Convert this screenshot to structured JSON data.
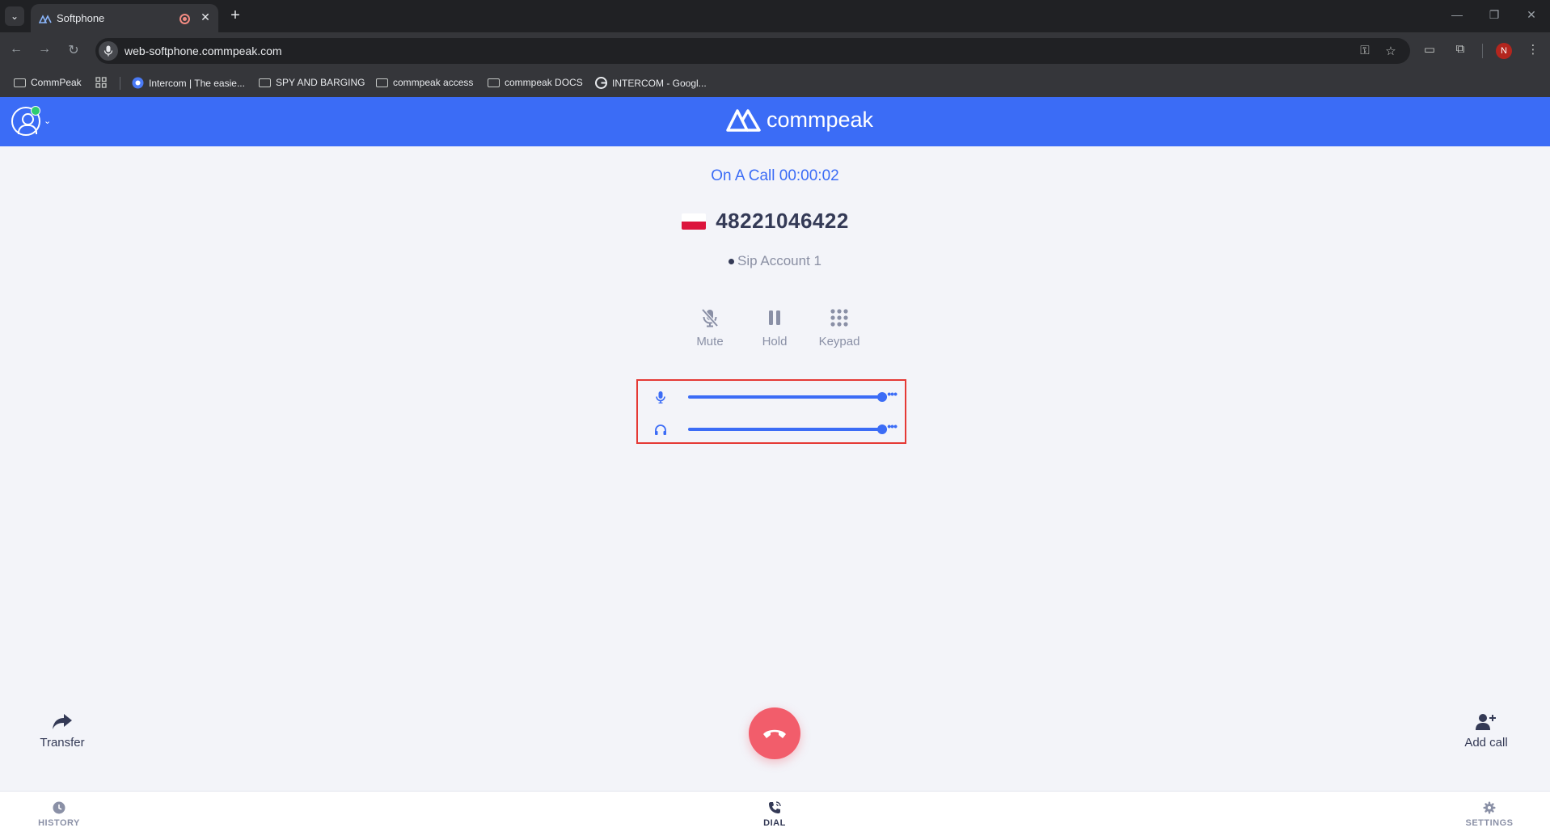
{
  "browser": {
    "tab_title": "Softphone",
    "url": "web-softphone.commpeak.com",
    "profile_initial": "N",
    "bookmarks": [
      {
        "label": "CommPeak"
      },
      {
        "label": "Intercom | The easie..."
      },
      {
        "label": "SPY AND BARGING"
      },
      {
        "label": "commpeak access"
      },
      {
        "label": "commpeak DOCS"
      },
      {
        "label": "INTERCOM - Googl..."
      }
    ]
  },
  "header": {
    "brand": "commpeak",
    "brand_color": "#3b6cf6",
    "user_status": "online"
  },
  "call": {
    "status": "On A Call 00:00:02",
    "number": "48221046422",
    "country_flag": "poland-flag",
    "account": "Sip Account 1",
    "controls": [
      {
        "label": "Mute",
        "icon": "microphone-off-icon"
      },
      {
        "label": "Hold",
        "icon": "pause-icon"
      },
      {
        "label": "Keypad",
        "icon": "keypad-icon"
      }
    ],
    "volume": {
      "microphone_level": 1.0,
      "speaker_level": 1.0
    }
  },
  "actions": {
    "transfer": "Transfer",
    "add_call": "Add call",
    "hangup_color": "#f25d6b"
  },
  "nav": {
    "history": "HISTORY",
    "dial": "DIAL",
    "settings": "SETTINGS",
    "active": "DIAL"
  }
}
